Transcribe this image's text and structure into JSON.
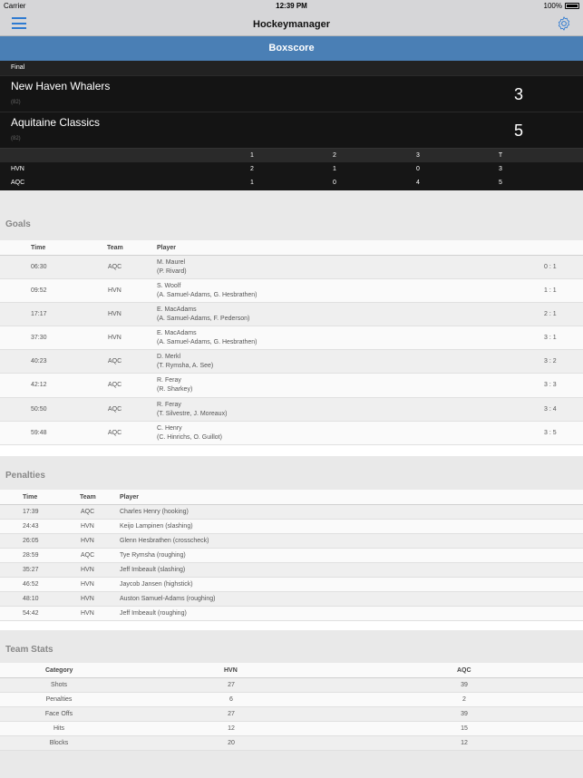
{
  "status_bar": {
    "carrier": "Carrier",
    "time": "12:39 PM",
    "battery": "100%"
  },
  "nav": {
    "title": "Hockeymanager",
    "menu_icon": "hamburger-icon",
    "settings_icon": "gear-icon"
  },
  "header": {
    "title": "Boxscore"
  },
  "scoreboard": {
    "status": "Final",
    "teams": [
      {
        "name": "New Haven Whalers",
        "record": "(82)",
        "score": "3"
      },
      {
        "name": "Aquitaine Classics",
        "record": "(82)",
        "score": "5"
      }
    ],
    "period_headers": [
      "1",
      "2",
      "3",
      "T"
    ],
    "periods": [
      {
        "team": "HVN",
        "values": [
          "2",
          "1",
          "0",
          "3"
        ]
      },
      {
        "team": "AQC",
        "values": [
          "1",
          "0",
          "4",
          "5"
        ]
      }
    ]
  },
  "goals": {
    "title": "Goals",
    "columns": {
      "time": "Time",
      "team": "Team",
      "player": "Player"
    },
    "rows": [
      {
        "time": "06:30",
        "team": "AQC",
        "scorer": "M. Maurel",
        "assists": "(P. Rivard)",
        "score": "0 : 1"
      },
      {
        "time": "09:52",
        "team": "HVN",
        "scorer": "S. Woolf",
        "assists": "(A. Samuel-Adams, G. Hesbrathen)",
        "score": "1 : 1"
      },
      {
        "time": "17:17",
        "team": "HVN",
        "scorer": "E. MacAdams",
        "assists": "(A. Samuel-Adams, F. Pederson)",
        "score": "2 : 1"
      },
      {
        "time": "37:30",
        "team": "HVN",
        "scorer": "E. MacAdams",
        "assists": "(A. Samuel-Adams, G. Hesbrathen)",
        "score": "3 : 1"
      },
      {
        "time": "40:23",
        "team": "AQC",
        "scorer": "D. Merkl",
        "assists": "(T. Rymsha, A. See)",
        "score": "3 : 2"
      },
      {
        "time": "42:12",
        "team": "AQC",
        "scorer": "R. Feray",
        "assists": "(R. Sharkey)",
        "score": "3 : 3"
      },
      {
        "time": "50:50",
        "team": "AQC",
        "scorer": "R. Feray",
        "assists": "(T. Silvestre, J. Moreaux)",
        "score": "3 : 4"
      },
      {
        "time": "59:48",
        "team": "AQC",
        "scorer": "C. Henry",
        "assists": "(C. Hinrichs, O. Guillot)",
        "score": "3 : 5"
      }
    ]
  },
  "penalties": {
    "title": "Penalties",
    "columns": {
      "time": "Time",
      "team": "Team",
      "player": "Player"
    },
    "rows": [
      {
        "time": "17:39",
        "team": "AQC",
        "player": "Charles Henry (hooking)"
      },
      {
        "time": "24:43",
        "team": "HVN",
        "player": "Keijo Lampinen (slashing)"
      },
      {
        "time": "26:05",
        "team": "HVN",
        "player": "Glenn Hesbrathen (crosscheck)"
      },
      {
        "time": "28:59",
        "team": "AQC",
        "player": "Tye Rymsha (roughing)"
      },
      {
        "time": "35:27",
        "team": "HVN",
        "player": "Jeff Imbeault (slashing)"
      },
      {
        "time": "46:52",
        "team": "HVN",
        "player": "Jaycob Jansen (highstick)"
      },
      {
        "time": "48:10",
        "team": "HVN",
        "player": "Auston Samuel-Adams (roughing)"
      },
      {
        "time": "54:42",
        "team": "HVN",
        "player": "Jeff Imbeault (roughing)"
      }
    ]
  },
  "team_stats": {
    "title": "Team Stats",
    "columns": {
      "category": "Category",
      "home": "HVN",
      "away": "AQC"
    },
    "rows": [
      {
        "category": "Shots",
        "home": "27",
        "away": "39"
      },
      {
        "category": "Penalties",
        "home": "6",
        "away": "2"
      },
      {
        "category": "Face Offs",
        "home": "27",
        "away": "39"
      },
      {
        "category": "Hits",
        "home": "12",
        "away": "15"
      },
      {
        "category": "Blocks",
        "home": "20",
        "away": "12"
      }
    ]
  },
  "colors": {
    "nav_bg": "#d6d6d8",
    "header_bg": "#4a7fb5",
    "accent": "#2f7bd1",
    "scoreboard_bg": "#161616"
  }
}
